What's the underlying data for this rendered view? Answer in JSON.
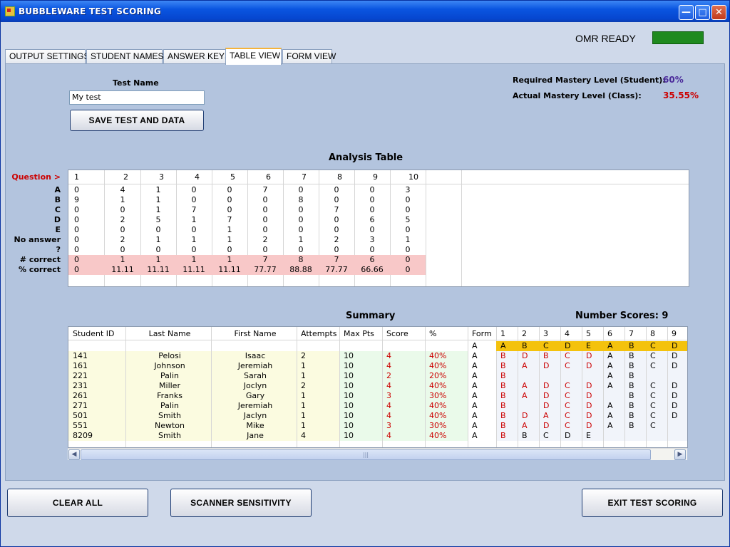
{
  "window": {
    "title": "BUBBLEWARE TEST SCORING",
    "min": "—",
    "max": "□",
    "close": "✕"
  },
  "status": {
    "label": "OMR READY",
    "color": "#1f8a1f"
  },
  "tabs": [
    "OUTPUT SETTINGS",
    "STUDENT NAMES",
    "ANSWER KEYS",
    "TABLE VIEW",
    "FORM VIEW"
  ],
  "active_tab": "TABLE VIEW",
  "test": {
    "name_label": "Test Name",
    "name_value": "My test",
    "save_button": "SAVE TEST AND DATA"
  },
  "mastery": {
    "required_label": "Required Mastery Level (Student):",
    "required_value": "60%",
    "actual_label": "Actual Mastery Level (Class):",
    "actual_value": "35.55%"
  },
  "analysis": {
    "title": "Analysis Table",
    "question_label": "Question >",
    "questions": [
      "1",
      "2",
      "3",
      "4",
      "5",
      "6",
      "7",
      "8",
      "9",
      "10"
    ],
    "rows": [
      {
        "label": "A",
        "values": [
          "0",
          "4",
          "1",
          "0",
          "0",
          "7",
          "0",
          "0",
          "0",
          "3"
        ]
      },
      {
        "label": "B",
        "values": [
          "9",
          "1",
          "1",
          "0",
          "0",
          "0",
          "8",
          "0",
          "0",
          "0"
        ]
      },
      {
        "label": "C",
        "values": [
          "0",
          "0",
          "1",
          "7",
          "0",
          "0",
          "0",
          "7",
          "0",
          "0"
        ]
      },
      {
        "label": "D",
        "values": [
          "0",
          "2",
          "5",
          "1",
          "7",
          "0",
          "0",
          "0",
          "6",
          "5"
        ]
      },
      {
        "label": "E",
        "values": [
          "0",
          "0",
          "0",
          "0",
          "1",
          "0",
          "0",
          "0",
          "0",
          "0"
        ]
      },
      {
        "label": "No answer",
        "values": [
          "0",
          "2",
          "1",
          "1",
          "1",
          "2",
          "1",
          "2",
          "3",
          "1"
        ]
      },
      {
        "label": "?",
        "values": [
          "0",
          "0",
          "0",
          "0",
          "0",
          "0",
          "0",
          "0",
          "0",
          "0"
        ]
      },
      {
        "label": "# correct",
        "values": [
          "0",
          "1",
          "1",
          "1",
          "1",
          "7",
          "8",
          "7",
          "6",
          "0"
        ]
      },
      {
        "label": "% correct",
        "values": [
          "0",
          "11.11",
          "11.11",
          "11.11",
          "11.11",
          "77.77",
          "88.88",
          "77.77",
          "66.66",
          "0"
        ]
      }
    ]
  },
  "summary": {
    "title": "Summary",
    "number_scores": "Number Scores: 9",
    "headers": [
      "Student ID",
      "Last Name",
      "First Name",
      "Attempts",
      "Max Pts",
      "Score",
      "%",
      "Form",
      "1",
      "2",
      "3",
      "4",
      "5",
      "6",
      "7",
      "8",
      "9"
    ],
    "key_row": [
      "",
      "",
      "",
      "",
      "",
      "",
      "",
      "A",
      "A",
      "B",
      "C",
      "D",
      "E",
      "A",
      "B",
      "C",
      "D"
    ],
    "rows": [
      [
        "141",
        "Pelosi",
        "Isaac",
        "2",
        "10",
        "4",
        "40%",
        "A",
        "B",
        "D",
        "B",
        "C",
        "D",
        "A",
        "B",
        "C",
        "D"
      ],
      [
        "161",
        "Johnson",
        "Jeremiah",
        "1",
        "10",
        "4",
        "40%",
        "A",
        "B",
        "A",
        "D",
        "C",
        "D",
        "A",
        "B",
        "C",
        "D"
      ],
      [
        "221",
        "Palin",
        "Sarah",
        "1",
        "10",
        "2",
        "20%",
        "A",
        "B",
        "",
        "",
        "",
        "",
        "A",
        "B",
        "",
        ""
      ],
      [
        "231",
        "Miller",
        "Joclyn",
        "2",
        "10",
        "4",
        "40%",
        "A",
        "B",
        "A",
        "D",
        "C",
        "D",
        "A",
        "B",
        "C",
        "D"
      ],
      [
        "261",
        "Franks",
        "Gary",
        "1",
        "10",
        "3",
        "30%",
        "A",
        "B",
        "A",
        "D",
        "C",
        "D",
        "",
        "B",
        "C",
        "D"
      ],
      [
        "271",
        "Palin",
        "Jeremiah",
        "1",
        "10",
        "4",
        "40%",
        "A",
        "B",
        "",
        "D",
        "C",
        "D",
        "A",
        "B",
        "C",
        "D"
      ],
      [
        "501",
        "Smith",
        "Jaclyn",
        "1",
        "10",
        "4",
        "40%",
        "A",
        "B",
        "D",
        "A",
        "C",
        "D",
        "A",
        "B",
        "C",
        "D"
      ],
      [
        "551",
        "Newton",
        "Mike",
        "1",
        "10",
        "3",
        "30%",
        "A",
        "B",
        "A",
        "D",
        "C",
        "D",
        "A",
        "B",
        "C",
        ""
      ],
      [
        "8209",
        "Smith",
        "Jane",
        "4",
        "10",
        "4",
        "40%",
        "A",
        "B",
        "B",
        "C",
        "D",
        "E",
        "",
        "",
        "",
        ""
      ]
    ],
    "scroll_grip": "|||"
  },
  "buttons": {
    "clear": "CLEAR ALL",
    "sensitivity": "SCANNER SENSITIVITY",
    "exit": "EXIT TEST SCORING"
  },
  "colors": {
    "accent_red": "#cc0000",
    "purple": "#4a2a9a",
    "highlight": "#f4c20d",
    "pink": "#f8c8c8",
    "pale_yellow": "#fbfbe0",
    "pale_green": "#eafaea"
  }
}
